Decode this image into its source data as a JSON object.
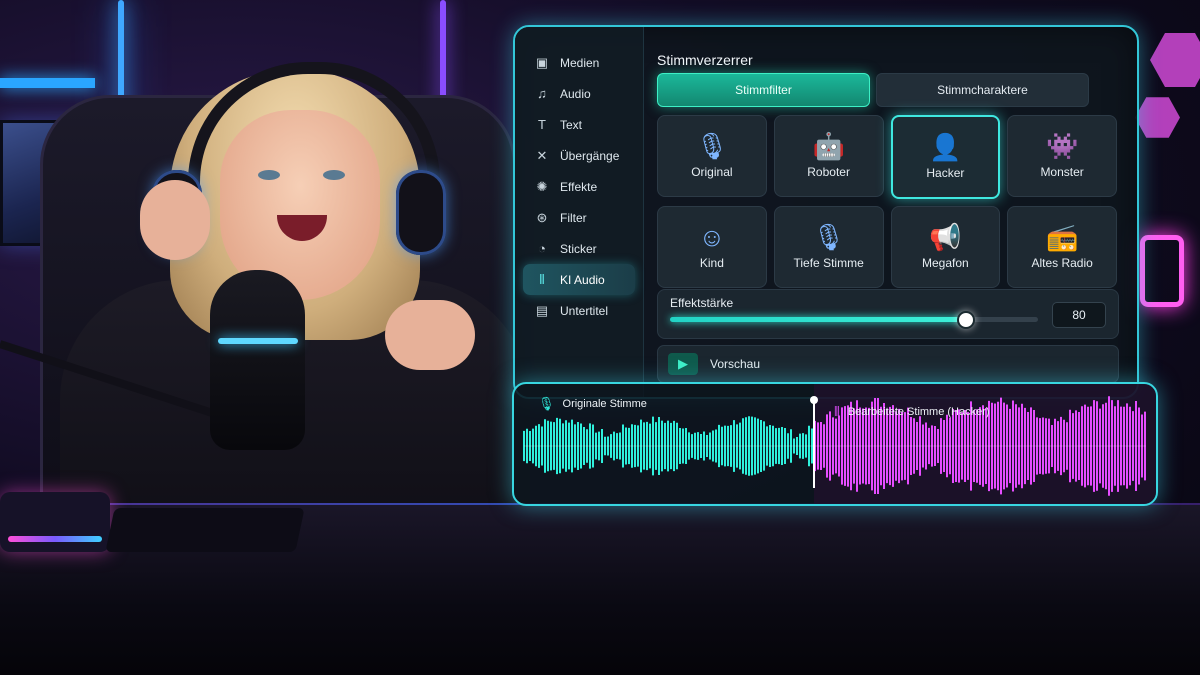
{
  "panel": {
    "title": "Stimmverzerrer",
    "sidebar": [
      {
        "label": "Medien",
        "icon": "media-icon",
        "glyph": "▣",
        "active": false
      },
      {
        "label": "Audio",
        "icon": "audio-icon",
        "glyph": "♫",
        "active": false
      },
      {
        "label": "Text",
        "icon": "text-icon",
        "glyph": "T",
        "active": false
      },
      {
        "label": "Übergänge",
        "icon": "transitions-icon",
        "glyph": "✕",
        "active": false
      },
      {
        "label": "Effekte",
        "icon": "effects-icon",
        "glyph": "✺",
        "active": false
      },
      {
        "label": "Filter",
        "icon": "filter-icon",
        "glyph": "⊛",
        "active": false
      },
      {
        "label": "Sticker",
        "icon": "sticker-icon",
        "glyph": "◔",
        "active": false
      },
      {
        "label": "KI Audio",
        "icon": "ai-audio-icon",
        "glyph": "⦀",
        "active": true
      },
      {
        "label": "Untertitel",
        "icon": "subtitles-icon",
        "glyph": "▤",
        "active": false
      }
    ],
    "tabs": [
      {
        "label": "Stimmfilter",
        "active": true
      },
      {
        "label": "Stimmcharaktere",
        "active": false
      }
    ],
    "filters": [
      {
        "label": "Original",
        "icon": "microphone-icon",
        "glyph": "🎙",
        "active": false
      },
      {
        "label": "Roboter",
        "icon": "robot-icon",
        "glyph": "🤖",
        "active": false
      },
      {
        "label": "Hacker",
        "icon": "hacker-icon",
        "glyph": "👤",
        "active": true
      },
      {
        "label": "Monster",
        "icon": "monster-icon",
        "glyph": "👾",
        "active": false
      },
      {
        "label": "Kind",
        "icon": "child-face-icon",
        "glyph": "☺",
        "active": false
      },
      {
        "label": "Tiefe Stimme",
        "icon": "deep-voice-mic-icon",
        "glyph": "🎙",
        "active": false
      },
      {
        "label": "Megafon",
        "icon": "megaphone-icon",
        "glyph": "📢",
        "active": false
      },
      {
        "label": "Altes Radio",
        "icon": "radio-icon",
        "glyph": "📻",
        "active": false
      }
    ],
    "strength": {
      "label": "Effektstärke",
      "value": "80",
      "level": 0.8
    },
    "preview": {
      "label": "Vorschau",
      "glyph": "▶"
    }
  },
  "waveform": {
    "original_label": "Originale Stimme",
    "edited_label": "Bearbeitete Stimme (Hacker)",
    "colors": {
      "original": "#2ff0dc",
      "edited": "#e64dff"
    }
  }
}
